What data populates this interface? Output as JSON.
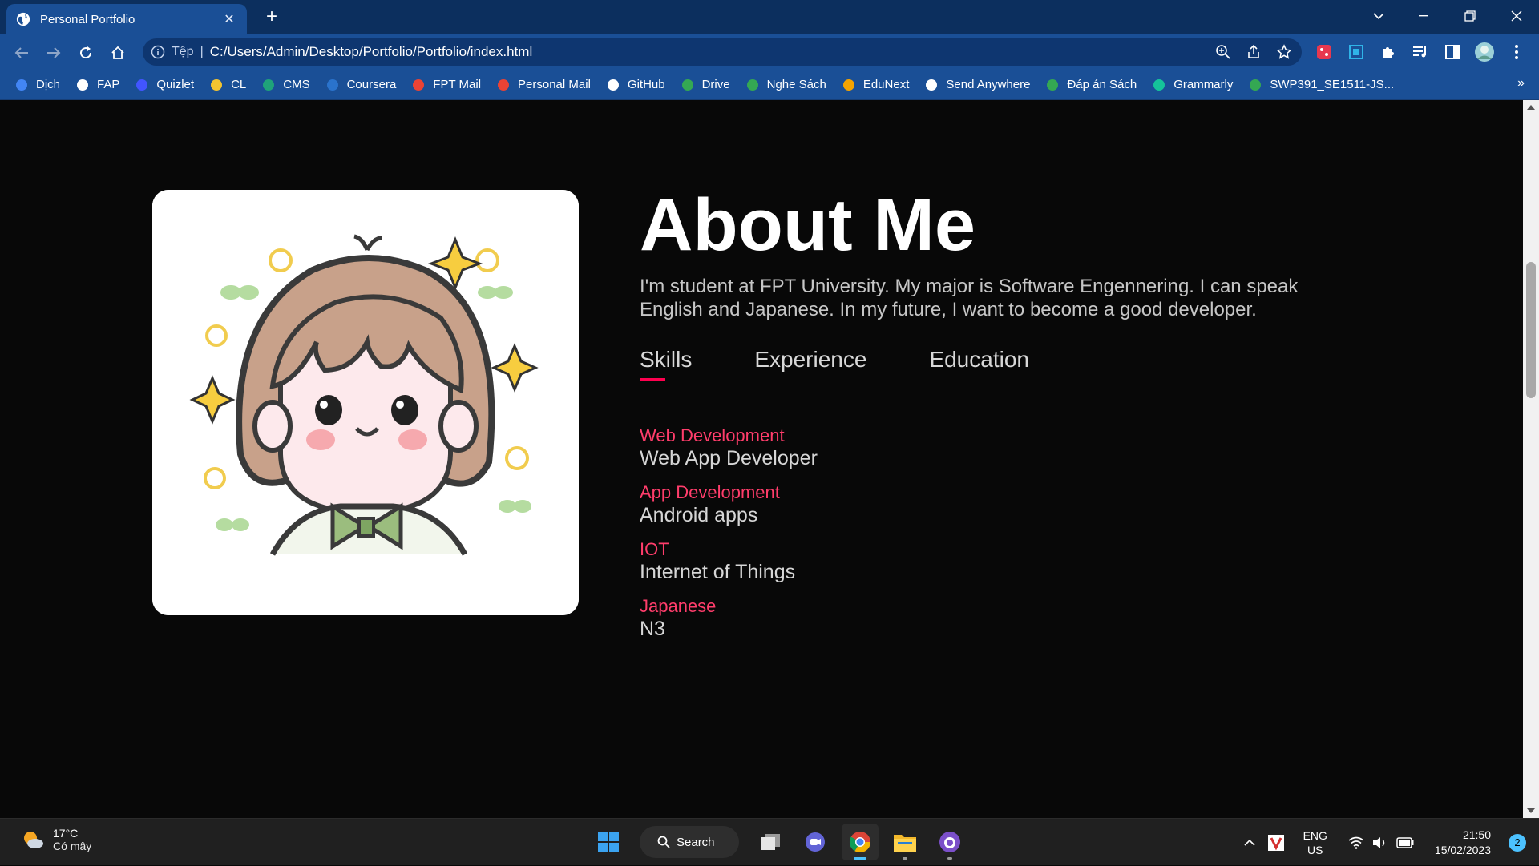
{
  "browser": {
    "tab_title": "Personal Portfolio",
    "new_tab": "+",
    "omnibox": {
      "scheme_label": "Tệp",
      "url": "C:/Users/Admin/Desktop/Portfolio/Portfolio/index.html"
    },
    "bookmarks": [
      {
        "label": "Dịch",
        "icon": "translate-icon",
        "color": "#4285f4"
      },
      {
        "label": "FAP",
        "icon": "globe-icon",
        "color": "#ffffff"
      },
      {
        "label": "Quizlet",
        "icon": "quizlet-icon",
        "color": "#4255ff"
      },
      {
        "label": "CL",
        "icon": "cl-icon",
        "color": "#f4c430"
      },
      {
        "label": "CMS",
        "icon": "cms-icon",
        "color": "#1fa37a"
      },
      {
        "label": "Coursera",
        "icon": "coursera-icon",
        "color": "#2a73cc"
      },
      {
        "label": "FPT Mail",
        "icon": "gmail-icon",
        "color": "#ea4335"
      },
      {
        "label": "Personal Mail",
        "icon": "gmail-icon",
        "color": "#ea4335"
      },
      {
        "label": "GitHub",
        "icon": "github-icon",
        "color": "#ffffff"
      },
      {
        "label": "Drive",
        "icon": "drive-icon",
        "color": "#34a853"
      },
      {
        "label": "Nghe Sách",
        "icon": "drive-icon",
        "color": "#34a853"
      },
      {
        "label": "EduNext",
        "icon": "edunext-icon",
        "color": "#f4a300"
      },
      {
        "label": "Send Anywhere",
        "icon": "send-anywhere-icon",
        "color": "#ffffff"
      },
      {
        "label": "Đáp án Sách",
        "icon": "drive-icon",
        "color": "#34a853"
      },
      {
        "label": "Grammarly",
        "icon": "grammarly-icon",
        "color": "#15c39a"
      },
      {
        "label": "SWP391_SE1511-JS...",
        "icon": "drive-icon",
        "color": "#34a853"
      }
    ],
    "bookmarks_more": "»"
  },
  "page": {
    "about_title": "About Me",
    "about_description": "I'm student at FPT University. My major is Software Engennering. I can speak English and Japanese. In my future, I want to become a good developer.",
    "tabs": [
      {
        "label": "Skills",
        "active": true
      },
      {
        "label": "Experience",
        "active": false
      },
      {
        "label": "Education",
        "active": false
      }
    ],
    "skills": [
      {
        "name": "Web Development",
        "desc": "Web App Developer"
      },
      {
        "name": "App Development",
        "desc": "Android apps"
      },
      {
        "name": "IOT",
        "desc": "Internet of Things"
      },
      {
        "name": "Japanese",
        "desc": "N3"
      }
    ],
    "accent_color": "#ff004f"
  },
  "taskbar": {
    "weather": {
      "temp": "17°C",
      "condition": "Có mây"
    },
    "search_label": "Search",
    "lang_top": "ENG",
    "lang_bottom": "US",
    "time": "21:50",
    "date": "15/02/2023",
    "notification_count": "2"
  }
}
